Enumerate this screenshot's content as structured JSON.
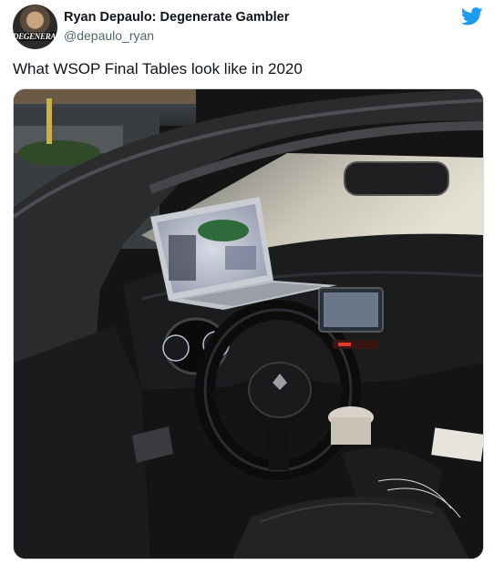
{
  "author": {
    "display_name": "Ryan Depaulo: Degenerate Gambler",
    "handle": "@depaulo_ryan",
    "avatar_text": "DEGENERATE"
  },
  "tweet": {
    "text": "What WSOP Final Tables look like in 2020"
  },
  "icons": {
    "brand": "twitter-bird-icon",
    "brand_color": "#1d9bf0"
  },
  "photo": {
    "subject": "car-interior-laptop-on-steering-wheel"
  }
}
